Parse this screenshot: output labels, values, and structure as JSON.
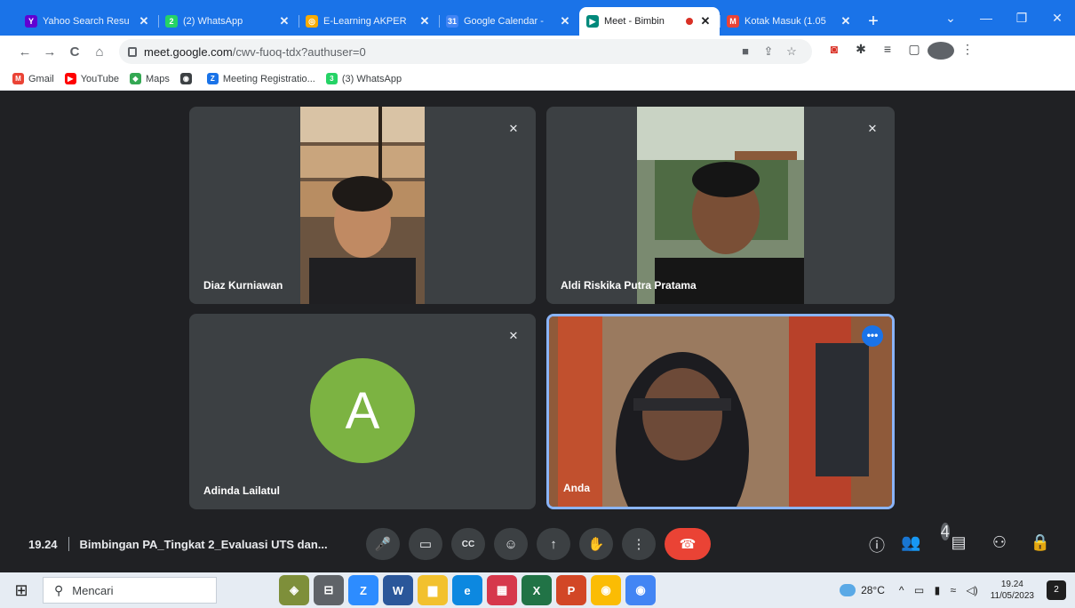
{
  "browser": {
    "tabs": [
      {
        "title": "Yahoo Search Resu",
        "favicon_color": "#6001d2",
        "favicon_glyph": "Y",
        "close": "✕",
        "active": false
      },
      {
        "title": "(2) WhatsApp",
        "favicon_color": "#25d366",
        "favicon_glyph": "2",
        "close": "✕",
        "active": false
      },
      {
        "title": "E-Learning AKPER",
        "favicon_color": "#f9ab00",
        "favicon_glyph": "◎",
        "close": "✕",
        "active": false
      },
      {
        "title": "Google Calendar -",
        "favicon_color": "#4285f4",
        "favicon_glyph": "31",
        "close": "✕",
        "active": false
      },
      {
        "title": "Meet - Bimbin",
        "favicon_color": "#00897b",
        "favicon_glyph": "▶",
        "close": "✕",
        "active": true,
        "recording": true
      },
      {
        "title": "Kotak Masuk (1.05",
        "favicon_color": "#ea4335",
        "favicon_glyph": "M",
        "close": "✕",
        "active": false
      }
    ],
    "new_tab": "+",
    "window_controls": [
      "⌄",
      "—",
      "❐",
      "✕"
    ],
    "nav": {
      "back": "←",
      "forward": "→",
      "reload": "C",
      "home": "⌂"
    },
    "url_host": "meet.google.com",
    "url_path": "/cwv-fuoq-tdx?authuser=0",
    "omnibox_icons": [
      "■",
      "⇪",
      "☆"
    ],
    "extension_icons": [
      "◙",
      "✱",
      "≡",
      "▢"
    ],
    "more_menu": "⋮",
    "bookmarks": [
      {
        "label": "Gmail",
        "icon_color": "#ea4335",
        "glyph": "M"
      },
      {
        "label": "YouTube",
        "icon_color": "#ff0000",
        "glyph": "▶"
      },
      {
        "label": "Maps",
        "icon_color": "#34a853",
        "glyph": "◆"
      },
      {
        "label": "",
        "icon_color": "#3c4043",
        "glyph": "◉"
      },
      {
        "label": "Meeting Registratio...",
        "icon_color": "#1a73e8",
        "glyph": "Z"
      },
      {
        "label": "(3) WhatsApp",
        "icon_color": "#25d366",
        "glyph": "3"
      }
    ]
  },
  "meet": {
    "participants": [
      {
        "name": "Diaz Kurniawan",
        "muted_icon": "✕"
      },
      {
        "name": "Aldi Riskika Putra Pratama",
        "muted_icon": "✕"
      },
      {
        "name": "Adinda Lailatul",
        "muted_icon": "✕",
        "avatar_letter": "A",
        "avatar_color": "#7cb342"
      },
      {
        "name": "Anda",
        "more_icon": "•••"
      }
    ],
    "time": "19.24",
    "title": "Bimbingan PA_Tingkat 2_Evaluasi UTS dan...",
    "controls": {
      "mic": "🎤",
      "camera": "▭",
      "captions": "CC",
      "emoji": "☺",
      "present": "↑",
      "raise_hand": "✋",
      "more": "⋮",
      "end_call": "☎"
    },
    "right_controls": {
      "info": "ⓘ",
      "people": "👥",
      "people_count": "4",
      "chat": "▤",
      "activities": "⚇",
      "host_controls": "🔒"
    }
  },
  "taskbar": {
    "start": "⊞",
    "search_placeholder": "Mencari",
    "search_icon": "⚲",
    "apps": [
      {
        "glyph": "◈",
        "color": "#7e8f3a"
      },
      {
        "glyph": "⊟",
        "color": "#5f6368"
      },
      {
        "glyph": "Z",
        "color": "#2d8cff"
      },
      {
        "glyph": "W",
        "color": "#2b579a"
      },
      {
        "glyph": "▆",
        "color": "#f2c12e"
      },
      {
        "glyph": "e",
        "color": "#0c88e0"
      },
      {
        "glyph": "▦",
        "color": "#d6384c"
      },
      {
        "glyph": "X",
        "color": "#217346"
      },
      {
        "glyph": "P",
        "color": "#d24726"
      },
      {
        "glyph": "◉",
        "color": "#fbbc04"
      },
      {
        "glyph": "◉",
        "color": "#4285f4"
      }
    ],
    "weather": "28°C",
    "tray_icons": [
      "^",
      "▭",
      "▮",
      "≈",
      "◁)"
    ],
    "clock_time": "19.24",
    "clock_date": "11/05/2023",
    "notification_count": "2"
  }
}
